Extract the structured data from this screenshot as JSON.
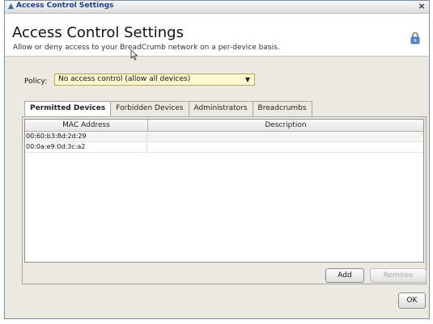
{
  "window": {
    "title": "Access Control Settings",
    "close_glyph": "×"
  },
  "header": {
    "heading": "Access Control Settings",
    "subheading": "Allow or deny access to your BreadCrumb network on a per-device basis.",
    "icon": "lock-icon"
  },
  "policy": {
    "label": "Policy:",
    "selected": "No access control (allow all devices)",
    "highlight_color": "#fff8d0"
  },
  "tabs": [
    {
      "label": "Permitted Devices",
      "active": true
    },
    {
      "label": "Forbidden Devices",
      "active": false
    },
    {
      "label": "Administrators",
      "active": false
    },
    {
      "label": "Breadcrumbs",
      "active": false
    }
  ],
  "table": {
    "columns": [
      "MAC Address",
      "Description"
    ],
    "rows": [
      {
        "mac": "00:60:b3:8d:2d:29",
        "description": ""
      },
      {
        "mac": "00:0a:e9:0d:3c:a2",
        "description": ""
      }
    ]
  },
  "buttons": {
    "add": "Add",
    "remove": "Remove",
    "ok": "OK"
  }
}
